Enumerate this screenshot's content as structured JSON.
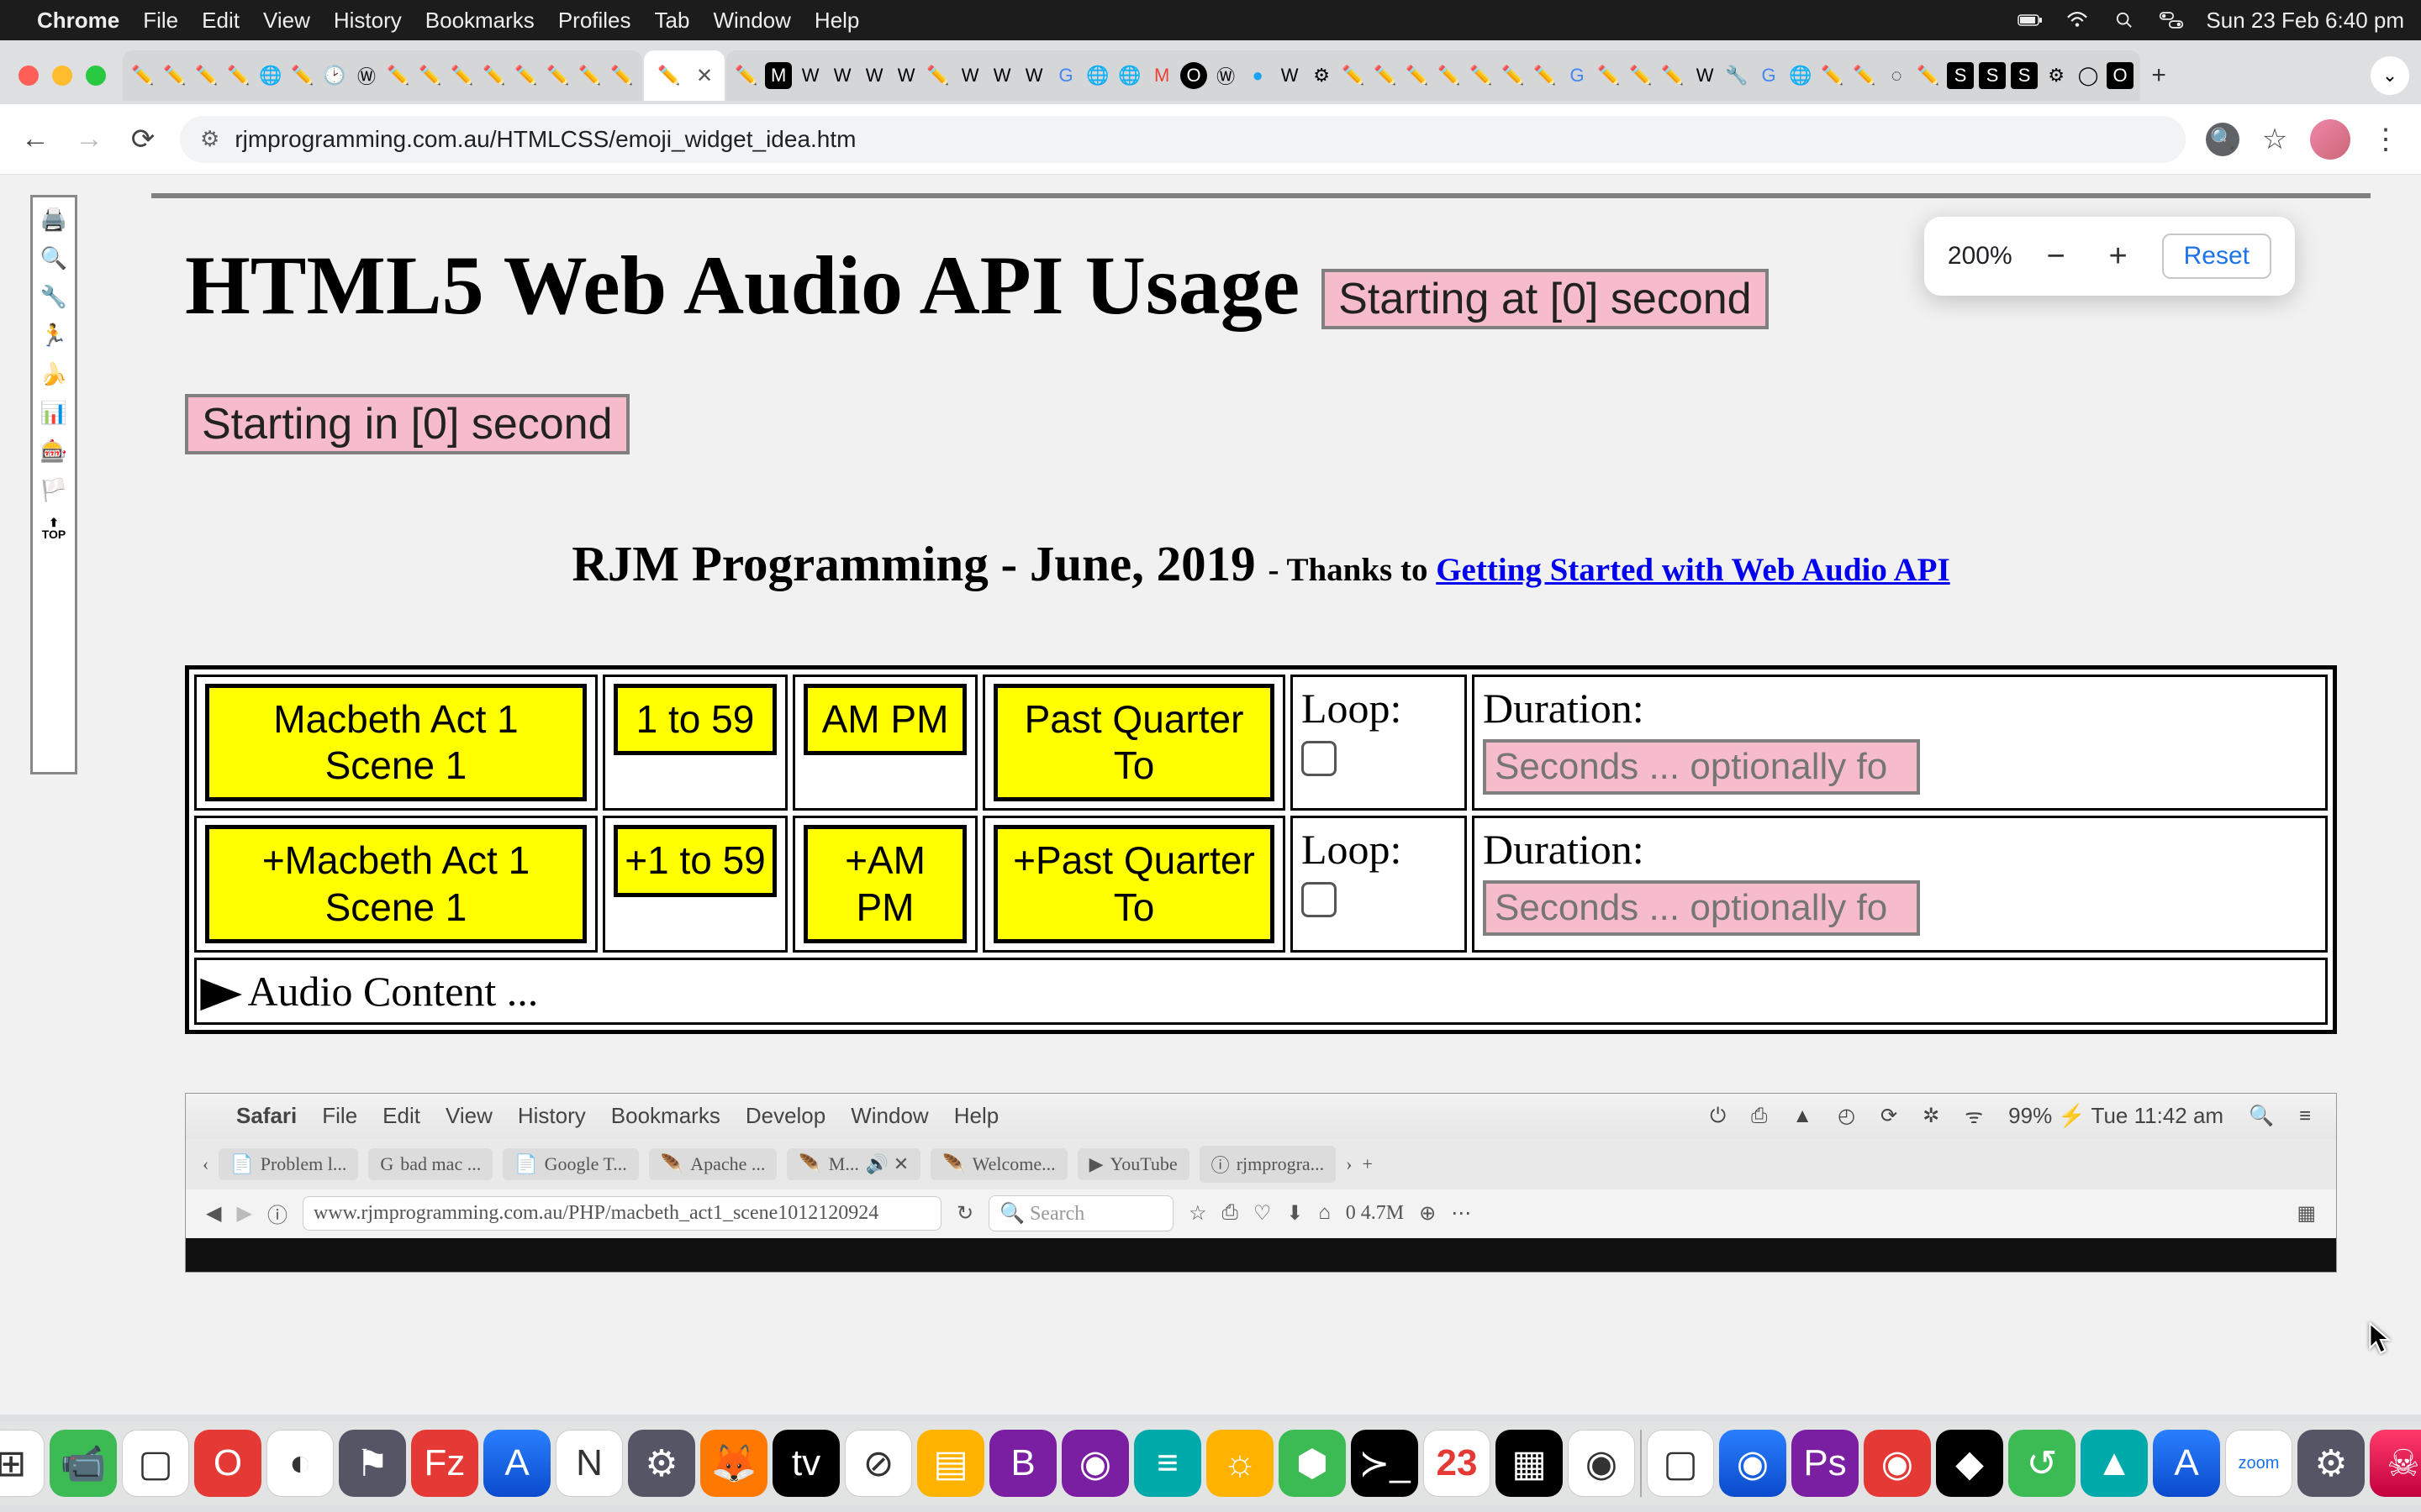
{
  "menubar": {
    "app": "Chrome",
    "items": [
      "File",
      "Edit",
      "View",
      "History",
      "Bookmarks",
      "Profiles",
      "Tab",
      "Window",
      "Help"
    ],
    "clock": "Sun 23 Feb  6:40 pm"
  },
  "chrome": {
    "url": "rjmprogramming.com.au/HTMLCSS/emoji_widget_idea.htm",
    "zoom_pct": "200%",
    "zoom_reset": "Reset"
  },
  "page": {
    "h1": "HTML5 Web Audio API Usage",
    "startAt": "Starting at [0] second",
    "startIn": "Starting in [0] second",
    "subtitle": "RJM Programming - June, 2019",
    "thanks_prefix": " - Thanks to ",
    "thanks_link": "Getting Started with Web Audio API",
    "row1": {
      "b1": "Macbeth Act 1 Scene 1",
      "b2": "1 to 59",
      "b3": "AM PM",
      "b4": "Past Quarter To",
      "loop": "Loop:",
      "dur": "Duration:",
      "dur_ph": "Seconds ... optionally fo"
    },
    "row2": {
      "b1": "+Macbeth Act 1 Scene 1",
      "b2": "+1 to 59",
      "b3": "+AM PM",
      "b4": "+Past Quarter To",
      "loop": "Loop:",
      "dur": "Duration:",
      "dur_ph": "Seconds ... optionally fo"
    },
    "audio_row": "Audio Content ..."
  },
  "safari": {
    "app": "Safari",
    "items": [
      "File",
      "Edit",
      "View",
      "History",
      "Bookmarks",
      "Develop",
      "Window",
      "Help"
    ],
    "clock": "99% ⚡  Tue 11:42 am",
    "tabs": [
      "Problem l...",
      "bad mac ...",
      "Google T...",
      "Apache ...",
      "M...",
      "Welcome...",
      "YouTube",
      "rjmprogra..."
    ],
    "url": "www.rjmprogramming.com.au/PHP/macbeth_act1_scene1012120924",
    "search_ph": "Search",
    "size": "0 4.7M"
  }
}
